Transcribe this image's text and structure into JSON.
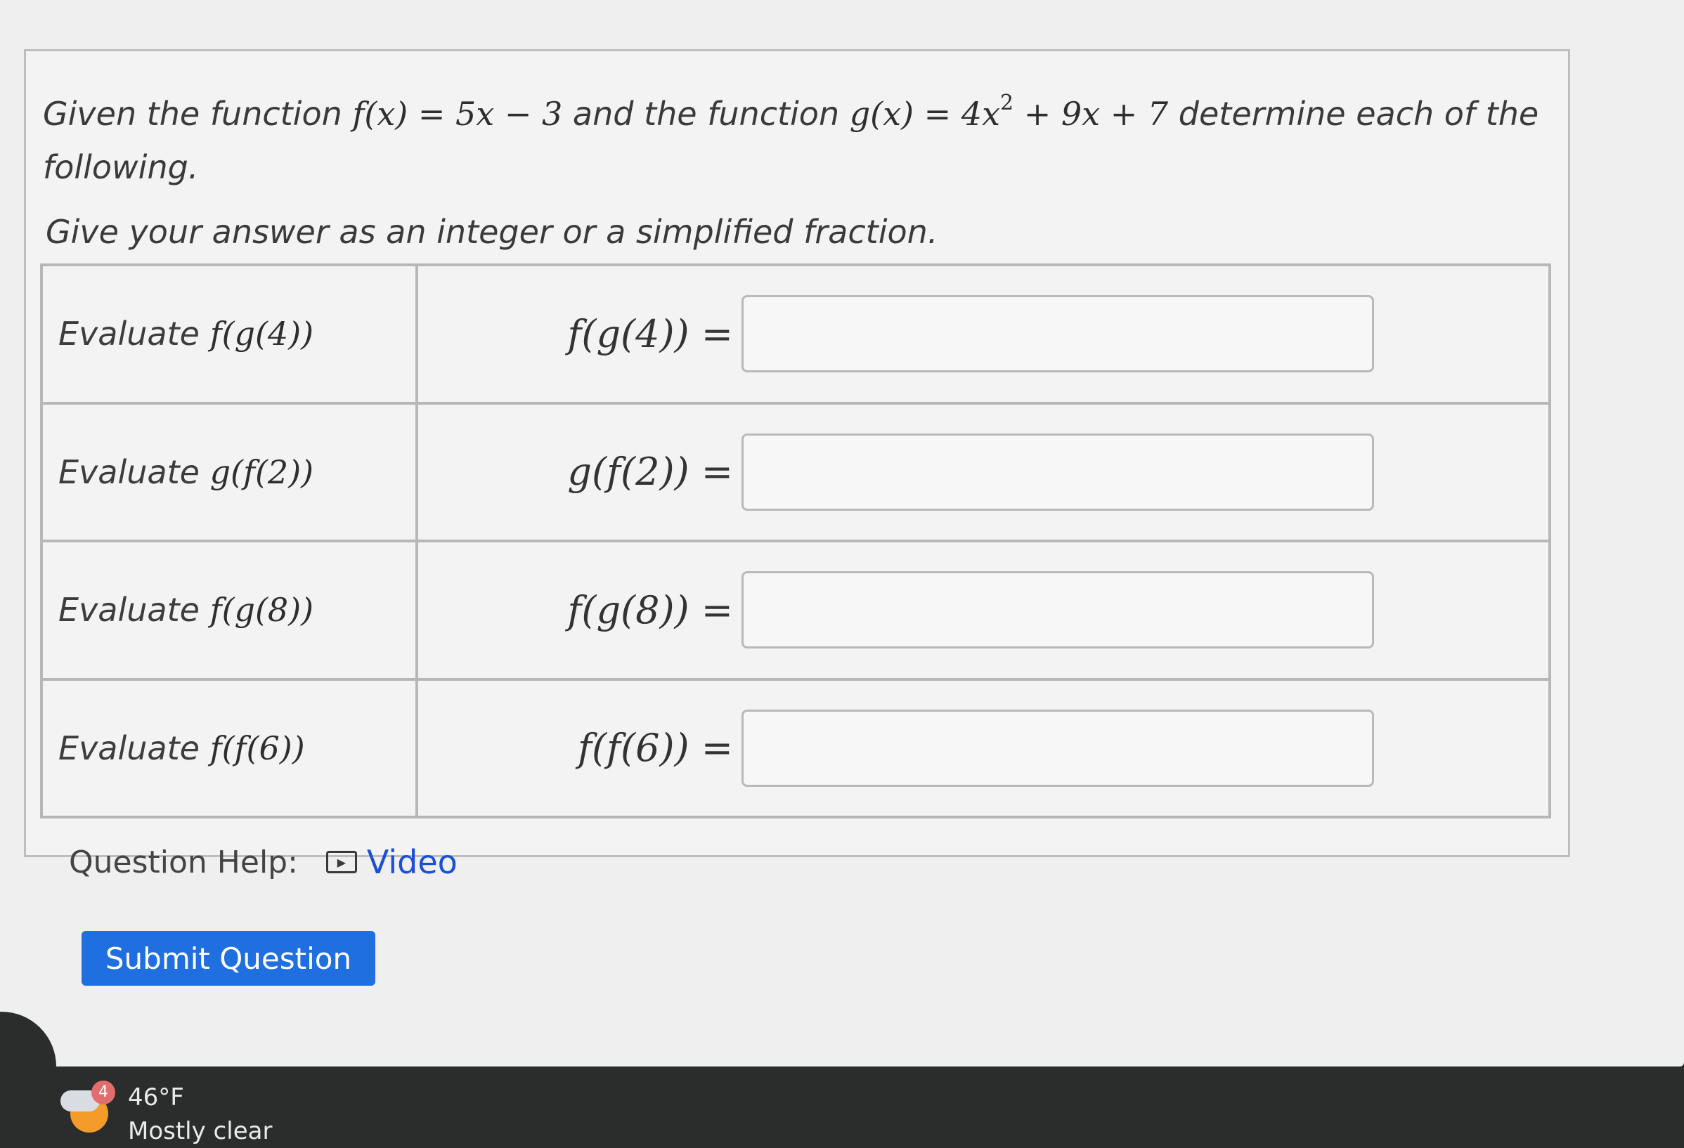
{
  "question": {
    "prompt_text_1": "Given the function",
    "f_def": "f(x) = 5x − 3",
    "prompt_text_2": "and the function",
    "g_def_main": "g(x) = 4x",
    "g_def_exp": "2",
    "g_def_tail": " + 9x + 7",
    "prompt_text_3": "determine each of the following.",
    "instruction": "Give your answer as an integer or a simplified fraction."
  },
  "rows": [
    {
      "label_prefix": "Evaluate",
      "label_math": "f(g(4))",
      "lhs": "f(g(4)) =",
      "value": ""
    },
    {
      "label_prefix": "Evaluate",
      "label_math": "g(f(2))",
      "lhs": "g(f(2)) =",
      "value": ""
    },
    {
      "label_prefix": "Evaluate",
      "label_math": "f(g(8))",
      "lhs": "f(g(8)) =",
      "value": ""
    },
    {
      "label_prefix": "Evaluate",
      "label_math": "f(f(6))",
      "lhs": "f(f(6)) =",
      "value": ""
    }
  ],
  "help": {
    "label": "Question Help:",
    "video_label": "Video",
    "video_icon": "play-icon"
  },
  "submit": {
    "label": "Submit Question"
  },
  "taskbar": {
    "weather_temp": "46°F",
    "weather_desc": "Mostly clear",
    "weather_badge": "4",
    "weather_icon": "partly-cloudy-icon"
  },
  "colors": {
    "submit_bg": "#1f6fe0",
    "link": "#1a4fd6"
  }
}
